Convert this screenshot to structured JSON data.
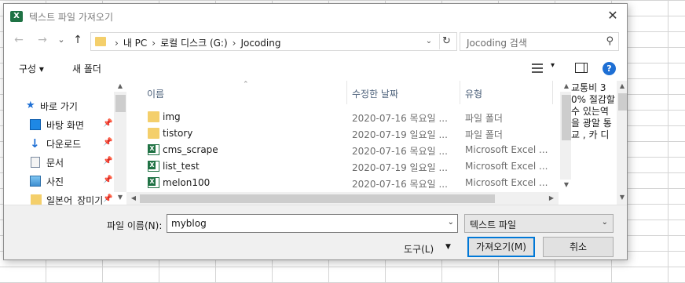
{
  "dialog": {
    "title": "텍스트 파일 가져오기",
    "close_glyph": "✕"
  },
  "nav": {
    "back_glyph": "←",
    "forward_glyph": "→",
    "recent_glyph": "⌄",
    "up_glyph": "↑",
    "breadcrumbs": [
      "내 PC",
      "로컬 디스크 (G:)",
      "Jocoding"
    ],
    "address_dropdown": "⌄",
    "refresh_glyph": "↻",
    "search_placeholder": "Jocoding 검색",
    "search_glyph": "⚲"
  },
  "toolbar": {
    "organize_label": "구성 ▾",
    "new_folder_label": "새 폴더",
    "view_dropdown": "▾",
    "help_glyph": "?"
  },
  "navpane": {
    "quick_access_label": "바로 가기",
    "items": [
      {
        "label": "바탕 화면",
        "icon": "desktop-icon"
      },
      {
        "label": "다운로드",
        "icon": "download-icon"
      },
      {
        "label": "문서",
        "icon": "document-icon"
      },
      {
        "label": "사진",
        "icon": "pictures-icon"
      },
      {
        "label": "일본어_장미기",
        "icon": "folder-icon"
      }
    ],
    "pin_glyph": "📌"
  },
  "filelist": {
    "columns": {
      "name": "이름",
      "date": "수정한 날짜",
      "type": "유형"
    },
    "rows": [
      {
        "name": "img",
        "date": "2020-07-16 목요일 ...",
        "type": "파일 폴더",
        "kind": "folder"
      },
      {
        "name": "tistory",
        "date": "2020-07-19 일요일 ...",
        "type": "파일 폴더",
        "kind": "folder"
      },
      {
        "name": "cms_scrape",
        "date": "2020-07-16 목요일 ...",
        "type": "Microsoft Excel ...",
        "kind": "excel"
      },
      {
        "name": "list_test",
        "date": "2020-07-19 일요일 ...",
        "type": "Microsoft Excel ...",
        "kind": "excel"
      },
      {
        "name": "melon100",
        "date": "2020-07-16 목요일 ...",
        "type": "Microsoft Excel ...",
        "kind": "excel"
      }
    ]
  },
  "side_text": "교통비 30% 절감할 수 있는역을 광알 통 교 , 카 디",
  "bottom": {
    "filename_label": "파일 이름(N):",
    "filename_value": "myblog",
    "filetype_value": "텍스트 파일",
    "tools_label": "도구(L)",
    "open_button": "가져오기(M)",
    "cancel_button": "취소"
  },
  "colors": {
    "excel_green": "#1f7244",
    "folder_yellow": "#f4cf6b",
    "accent_blue": "#0078d7"
  }
}
